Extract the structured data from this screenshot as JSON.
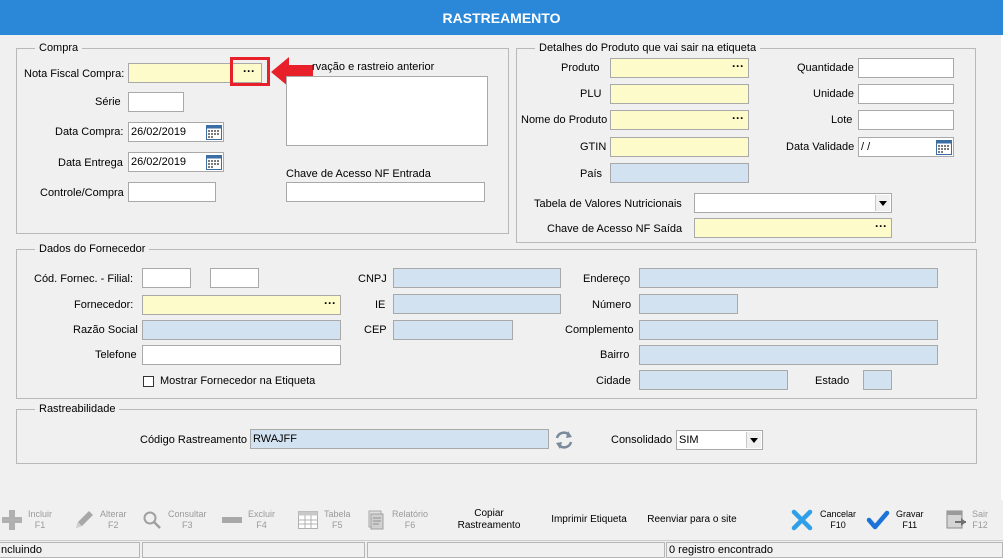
{
  "window": {
    "title": "RASTREAMENTO"
  },
  "compra": {
    "legend": "Compra",
    "nota_fiscal_label": "Nota Fiscal Compra:",
    "nota_fiscal_value": "",
    "serie_label": "Série",
    "serie_value": "",
    "data_compra_label": "Data Compra:",
    "data_compra_value": "26/02/2019",
    "data_entrega_label": "Data Entrega",
    "data_entrega_value": "26/02/2019",
    "controle_label": "Controle/Compra",
    "controle_value": "",
    "observacao_label": "rvação e rastreio anterior",
    "observacao_value": "",
    "chave_entrada_label": "Chave de Acesso NF Entrada",
    "chave_entrada_value": ""
  },
  "produto": {
    "legend": "Detalhes do Produto que vai sair na etiqueta",
    "produto_label": "Produto",
    "plu_label": "PLU",
    "nome_label": "Nome do Produto",
    "gtin_label": "GTIN",
    "pais_label": "País",
    "quantidade_label": "Quantidade",
    "unidade_label": "Unidade",
    "lote_label": "Lote",
    "data_validade_label": "Data Validade",
    "data_validade_value": " /  /",
    "tabela_label": "Tabela de Valores Nutricionais",
    "tabela_value": "",
    "chave_saida_label": "Chave de Acesso NF Saída"
  },
  "fornecedor": {
    "legend": "Dados do Fornecedor",
    "cod_label": "Cód. Fornec. - Filial:",
    "fornecedor_label": "Fornecedor:",
    "razao_label": "Razão Social",
    "telefone_label": "Telefone",
    "mostrar_label": "Mostrar Fornecedor na Etiqueta",
    "cnpj_label": "CNPJ",
    "ie_label": "IE",
    "cep_label": "CEP",
    "endereco_label": "Endereço",
    "numero_label": "Número",
    "complemento_label": "Complemento",
    "bairro_label": "Bairro",
    "cidade_label": "Cidade",
    "estado_label": "Estado"
  },
  "rastreabilidade": {
    "legend": "Rastreabilidade",
    "codigo_label": "Código Rastreamento",
    "codigo_value": "RWAJFF",
    "consolidado_label": "Consolidado",
    "consolidado_value": "SIM"
  },
  "toolbar": {
    "incluir": "Incluir\nF1",
    "alterar": "Alterar\nF2",
    "consultar": "Consultar\nF3",
    "excluir": "Excluir\nF4",
    "tabela": "Tabela\nF5",
    "relatorio": "Relatório\nF6",
    "copiar": "Copiar\nRastreamento",
    "imprimir": "Imprimir Etiqueta",
    "reenviar": "Reenviar para o site",
    "cancelar": "Cancelar\nF10",
    "gravar": "Gravar\nF11",
    "sair": "Sair\nF12"
  },
  "status": {
    "mode": "ncluindo",
    "records": "0 registro encontrado"
  },
  "colors": {
    "title_bar": "#2b88d8",
    "required_field": "#fdfbc9",
    "readonly_field": "#d3e2f1",
    "highlight_arrow": "#e8202a"
  }
}
